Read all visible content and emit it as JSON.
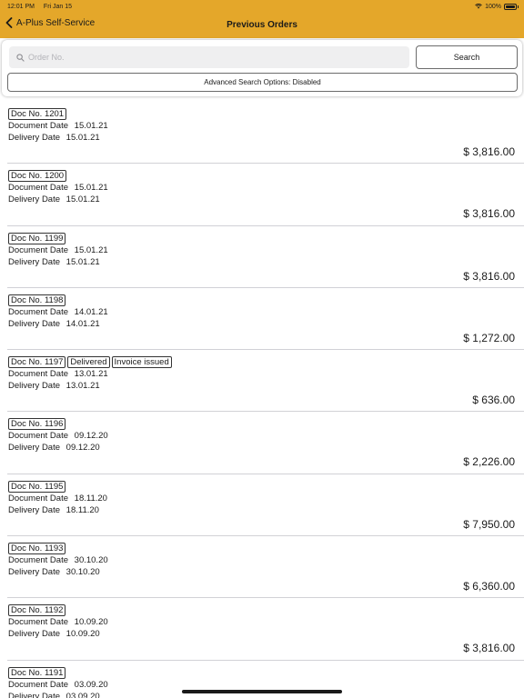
{
  "status_bar": {
    "time": "12:01 PM",
    "date": "Fri Jan 15",
    "battery": "100%"
  },
  "nav": {
    "back_label": "A-Plus Self-Service",
    "title": "Previous Orders"
  },
  "search": {
    "placeholder": "Order No.",
    "value": "",
    "button_label": "Search",
    "advanced_label": "Advanced Search Options: Disabled"
  },
  "labels": {
    "document_date": "Document Date",
    "delivery_date": "Delivery Date"
  },
  "orders": [
    {
      "doc": "Doc No. 1201",
      "badges": [],
      "document_date": "15.01.21",
      "delivery_date": "15.01.21",
      "amount": "$ 3,816.00"
    },
    {
      "doc": "Doc No. 1200",
      "badges": [],
      "document_date": "15.01.21",
      "delivery_date": "15.01.21",
      "amount": "$ 3,816.00"
    },
    {
      "doc": "Doc No. 1199",
      "badges": [],
      "document_date": "15.01.21",
      "delivery_date": "15.01.21",
      "amount": "$ 3,816.00"
    },
    {
      "doc": "Doc No. 1198",
      "badges": [],
      "document_date": "14.01.21",
      "delivery_date": "14.01.21",
      "amount": "$ 1,272.00"
    },
    {
      "doc": "Doc No. 1197",
      "badges": [
        "Delivered",
        "Invoice issued"
      ],
      "document_date": "13.01.21",
      "delivery_date": "13.01.21",
      "amount": "$ 636.00"
    },
    {
      "doc": "Doc No. 1196",
      "badges": [],
      "document_date": "09.12.20",
      "delivery_date": "09.12.20",
      "amount": "$ 2,226.00"
    },
    {
      "doc": "Doc No. 1195",
      "badges": [],
      "document_date": "18.11.20",
      "delivery_date": "18.11.20",
      "amount": "$ 7,950.00"
    },
    {
      "doc": "Doc No. 1193",
      "badges": [],
      "document_date": "30.10.20",
      "delivery_date": "30.10.20",
      "amount": "$ 6,360.00"
    },
    {
      "doc": "Doc No. 1192",
      "badges": [],
      "document_date": "10.09.20",
      "delivery_date": "10.09.20",
      "amount": "$ 3,816.00"
    },
    {
      "doc": "Doc No. 1191",
      "badges": [],
      "document_date": "03.09.20",
      "delivery_date": "03.09.20",
      "amount": ""
    }
  ],
  "colors": {
    "accent": "#e4a72a",
    "divider": "#d1d1d6"
  },
  "icons": {
    "back": "chevron-left-icon",
    "search": "search-icon",
    "wifi": "wifi-icon",
    "battery": "battery-icon"
  }
}
